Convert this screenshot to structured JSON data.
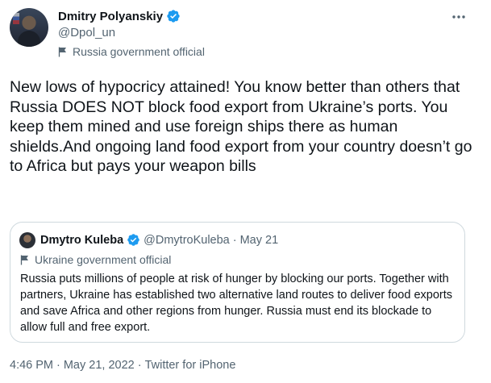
{
  "author": {
    "display_name": "Dmitry Polyanskiy",
    "handle": "@Dpol_un",
    "label": "Russia government official"
  },
  "tweet_text": "New lows of hypocricy attained! You know better than others that Russia DOES NOT block food export from Ukraine’s ports. You keep them mined and use foreign ships there as human shields.And ongoing land food export from your country doesn’t go to Africa but pays your weapon bills",
  "quoted": {
    "display_name": "Dmytro Kuleba",
    "handle": "@DmytroKuleba",
    "separator": "·",
    "date": "May 21",
    "label": "Ukraine government official",
    "text": "Russia puts millions of people at risk of hunger by blocking our ports. Together with partners, Ukraine has established two alternative land routes to deliver food exports and save Africa and other regions from hunger. Russia must end its blockade to allow full and free export."
  },
  "meta": {
    "time": "4:46 PM",
    "dot1": "·",
    "date": "May 21, 2022",
    "dot2": "·",
    "source": "Twitter for iPhone"
  },
  "icons": {
    "verified": "verified-badge-icon",
    "label": "flag-icon",
    "more": "more-options-icon"
  },
  "colors": {
    "verified_blue": "#1d9bf0",
    "secondary_text": "#536471",
    "primary_text": "#0f1419",
    "border": "#cfd9de"
  }
}
